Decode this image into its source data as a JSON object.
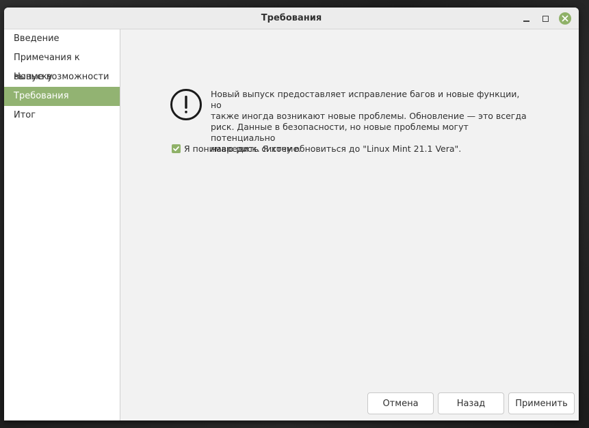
{
  "window": {
    "title": "Требования"
  },
  "sidebar": {
    "items": [
      {
        "label": "Введение",
        "active": false
      },
      {
        "label": "Примечания к выпуску",
        "active": false
      },
      {
        "label": "Новые возможности",
        "active": false
      },
      {
        "label": "Требования",
        "active": true
      },
      {
        "label": "Итог",
        "active": false
      }
    ]
  },
  "main": {
    "warning_icon": "exclamation-circle-icon",
    "warning_lines": [
      "Новый выпуск предоставляет исправление багов и новые функции, но",
      "также иногда возникают новые проблемы. Обновление — это всегда",
      "риск. Данные в безопасности, но новые проблемы могут потенциально",
      "навредить системе."
    ],
    "checkbox": {
      "label": "Я понимаю риск. Я хочу обновиться до \"Linux Mint 21.1 Vera\".",
      "checked": true
    }
  },
  "buttons": {
    "cancel": "Отмена",
    "back": "Назад",
    "apply": "Применить"
  },
  "colors": {
    "accent": "#92b372",
    "close_button": "#8fb168"
  }
}
